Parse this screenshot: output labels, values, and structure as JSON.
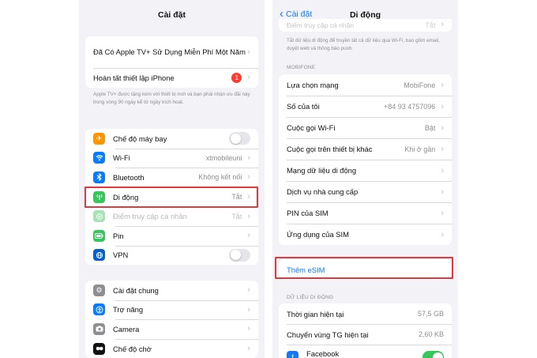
{
  "left": {
    "title": "Cài đặt",
    "promo": {
      "appletv_label": "Đã Có Apple TV+ Sử Dụng Miễn Phí Một Năm",
      "setup_label": "Hoàn tất thiết lập iPhone",
      "setup_badge": "1",
      "footnote": "Apple TV+ được tặng kèm với thiết bị mới và bạn phải nhận ưu đãi này trong vòng 90 ngày kể từ ngày kích hoạt."
    },
    "connectivity": [
      {
        "label": "Chế độ máy bay",
        "value": "",
        "icon": "airplane-icon",
        "color": "#ff9500",
        "toggle": "off"
      },
      {
        "label": "Wi-Fi",
        "value": "xtmobileuni",
        "icon": "wifi-icon",
        "color": "#0a7cff"
      },
      {
        "label": "Bluetooth",
        "value": "Không kết nối",
        "icon": "bluetooth-icon",
        "color": "#0a7cff"
      },
      {
        "label": "Di động",
        "value": "Tắt",
        "icon": "antenna-icon",
        "color": "#34c759"
      },
      {
        "label": "Điểm truy cập cá nhân",
        "value": "Tắt",
        "icon": "hotspot-icon",
        "color": "#8fdca2"
      },
      {
        "label": "Pin",
        "value": "",
        "icon": "battery-icon",
        "color": "#34c759"
      },
      {
        "label": "VPN",
        "value": "",
        "icon": "globe-icon",
        "color": "#0a5fd0",
        "toggle": "off"
      }
    ],
    "general": [
      {
        "label": "Cài đặt chung",
        "icon": "gear-icon",
        "color": "#8e8e93"
      },
      {
        "label": "Trợ năng",
        "icon": "accessibility-icon",
        "color": "#0a7cff"
      },
      {
        "label": "Camera",
        "icon": "camera-icon",
        "color": "#8e8e93"
      },
      {
        "label": "Chế độ chờ",
        "icon": "standby-icon",
        "color": "#111111"
      }
    ]
  },
  "right": {
    "back_label": "Cài đặt",
    "title": "Di động",
    "top_faded": {
      "label": "Điểm truy cập cá nhân",
      "value": "Tắt"
    },
    "top_footnote": "Tắt dữ liệu di động để truyền tất cả dữ liệu qua Wi-Fi, bao gồm email, duyệt web và thông báo push.",
    "carrier_header": "MOBIFONE",
    "carrier_rows": [
      {
        "label": "Lựa chọn mạng",
        "value": "MobiFone"
      },
      {
        "label": "Số của tôi",
        "value": "+84 93 4757096"
      },
      {
        "label": "Cuộc gọi Wi-Fi",
        "value": "Bật"
      },
      {
        "label": "Cuộc gọi trên thiết bị khác",
        "value": "Khi ở gần"
      },
      {
        "label": "Mạng dữ liệu di động",
        "value": ""
      },
      {
        "label": "Dịch vụ nhà cung cấp",
        "value": ""
      },
      {
        "label": "PIN của SIM",
        "value": ""
      },
      {
        "label": "Ứng dụng của SIM",
        "value": ""
      }
    ],
    "esim_label": "Thêm eSIM",
    "data_header": "DỮ LIỆU DI ĐỘNG",
    "data_rows": [
      {
        "label": "Thời gian hiện tại",
        "value": "57,5 GB"
      },
      {
        "label": "Chuyển vùng TG hiện tại",
        "value": "2,60 KB"
      }
    ],
    "facebook_label": "Facebook",
    "facebook_toggle": "on"
  },
  "colors": {
    "highlight": "#e0393e",
    "accent": "#0a7cff"
  }
}
